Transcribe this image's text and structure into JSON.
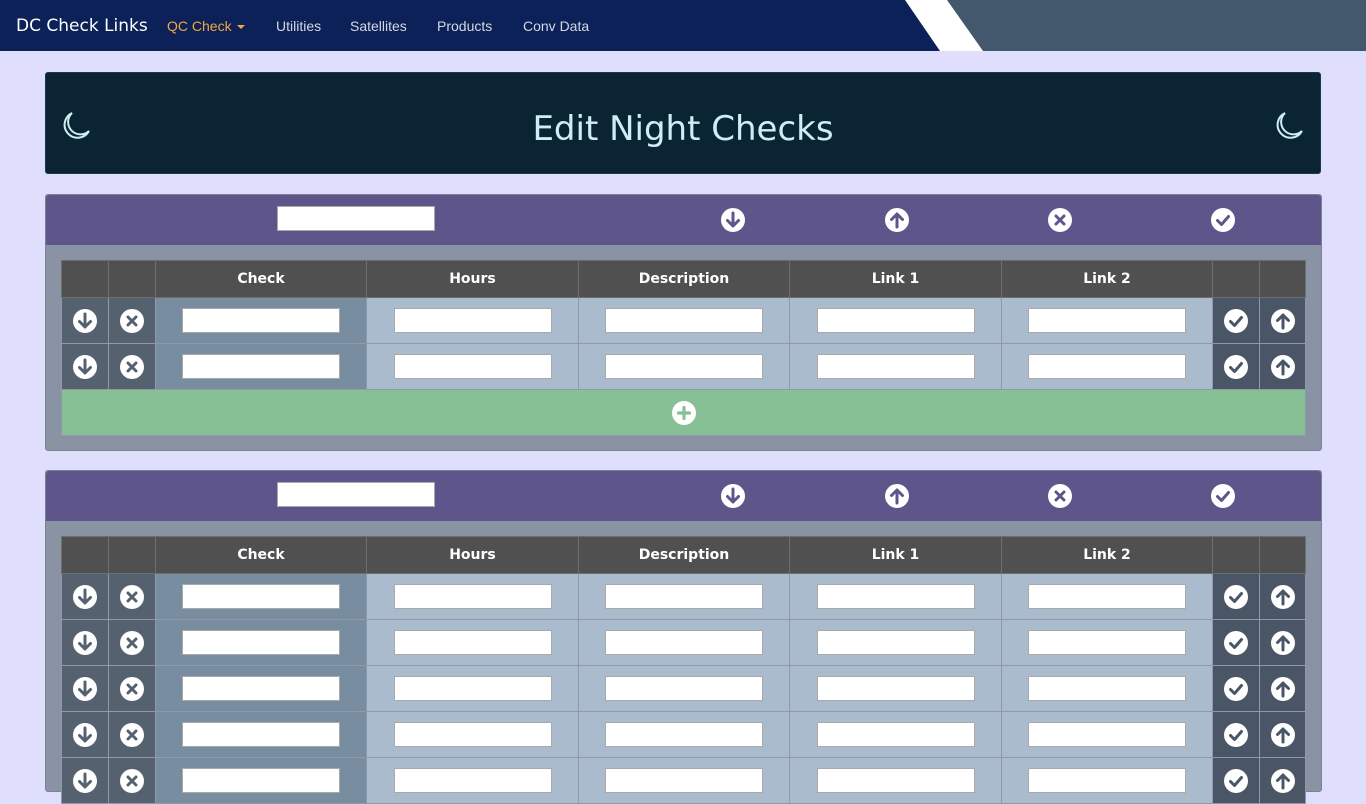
{
  "navbar": {
    "brand": "DC Check Links",
    "items": [
      {
        "label": "QC Check",
        "active": true,
        "dropdown": true
      },
      {
        "label": "Utilities"
      },
      {
        "label": "Satellites"
      },
      {
        "label": "Products"
      },
      {
        "label": "Conv Data"
      }
    ],
    "colors": {
      "bg": "#0b2157",
      "active": "#f4a742",
      "text": "#d5d8e2"
    }
  },
  "title_panel": {
    "title": "Edit Night Checks",
    "icon": "moon-icon",
    "colors": {
      "bg": "#0a2434",
      "text": "#cdeef3"
    }
  },
  "table_columns": [
    "",
    "",
    "Check",
    "Hours",
    "Description",
    "Link 1",
    "Link 2",
    "",
    ""
  ],
  "header_icons": [
    "move-down-icon",
    "move-up-icon",
    "delete-icon",
    "confirm-icon"
  ],
  "row_icons": {
    "left": [
      "move-down-icon",
      "delete-icon"
    ],
    "right": [
      "confirm-icon",
      "move-up-icon"
    ]
  },
  "groups": [
    {
      "name": "",
      "rows": [
        {
          "check": "",
          "hours": "",
          "description": "",
          "link1": "",
          "link2": ""
        },
        {
          "check": "",
          "hours": "",
          "description": "",
          "link1": "",
          "link2": ""
        }
      ],
      "add_icon": "add-circle-icon"
    },
    {
      "name": "",
      "rows": [
        {
          "check": "",
          "hours": "",
          "description": "",
          "link1": "",
          "link2": ""
        },
        {
          "check": "",
          "hours": "",
          "description": "",
          "link1": "",
          "link2": ""
        },
        {
          "check": "",
          "hours": "",
          "description": "",
          "link1": "",
          "link2": ""
        },
        {
          "check": "",
          "hours": "",
          "description": "",
          "link1": "",
          "link2": ""
        },
        {
          "check": "",
          "hours": "",
          "description": "",
          "link1": "",
          "link2": ""
        }
      ]
    }
  ],
  "colors": {
    "page_bg": "#dfdffd",
    "panel_header": "#5e558b",
    "table_header": "#505050",
    "add_row": "#88c096"
  }
}
